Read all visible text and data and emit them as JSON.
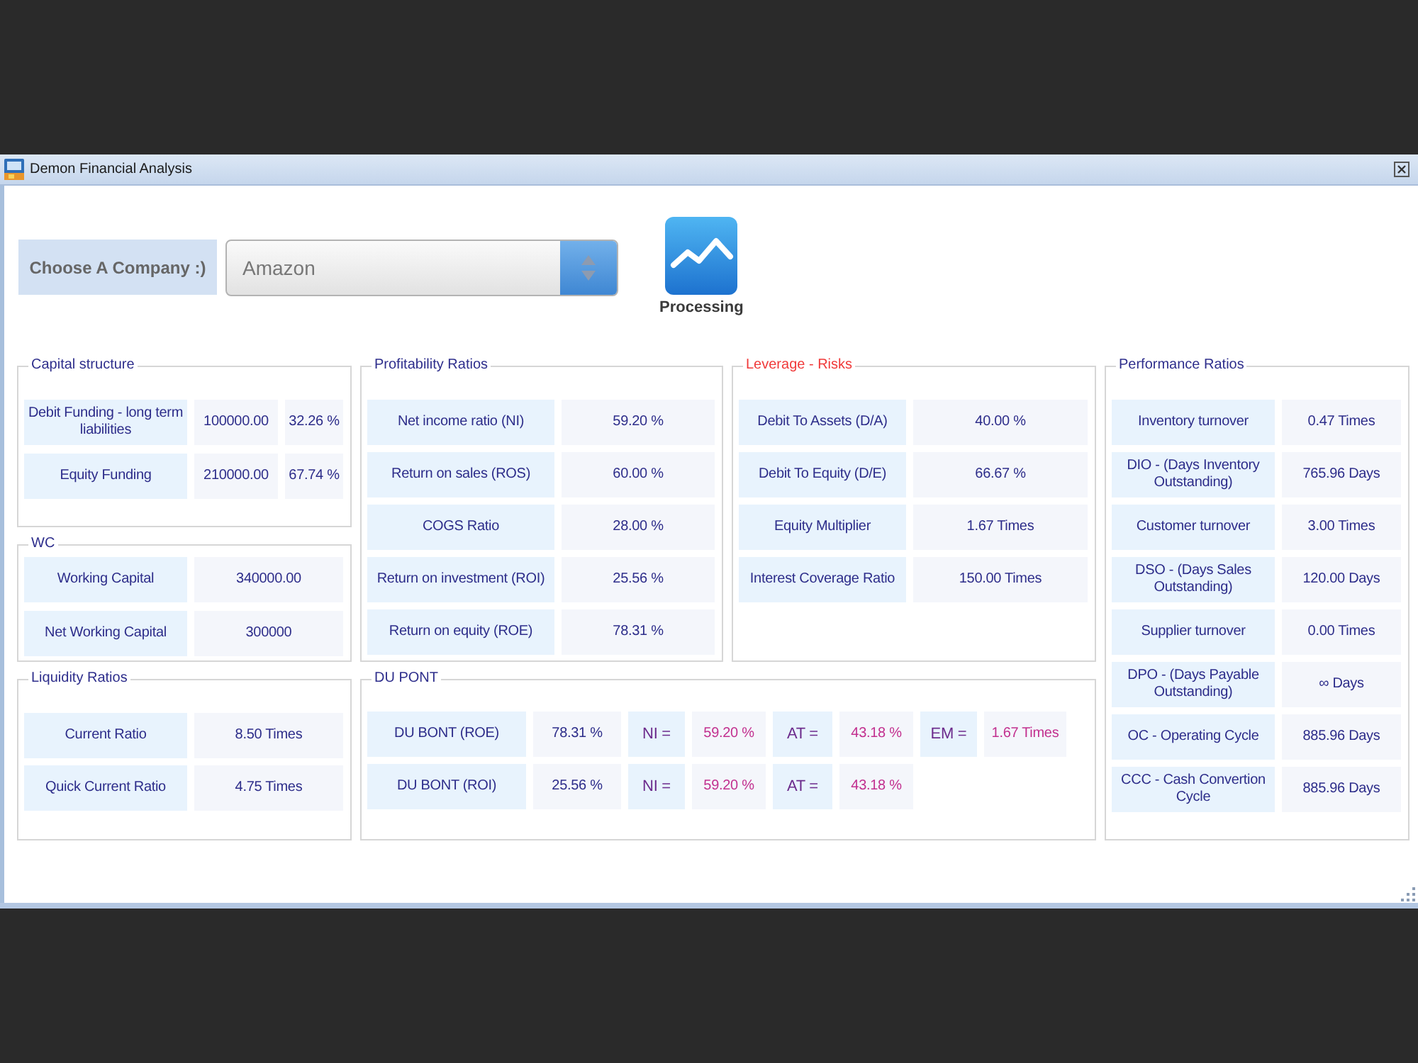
{
  "window": {
    "title": "Demon Financial Analysis"
  },
  "company_picker": {
    "label": "Choose A Company :)",
    "value": "Amazon"
  },
  "processing_button": {
    "label": "Processing"
  },
  "capital_structure": {
    "title": "Capital structure",
    "highlighted": false,
    "rows": [
      {
        "label": "Debit Funding - long term liabilities",
        "value": "100000.00",
        "share": "32.26 %"
      },
      {
        "label": "Equity Funding",
        "value": "210000.00",
        "share": "67.74 %"
      }
    ]
  },
  "profitability_ratios": {
    "title": "Profitability Ratios",
    "highlighted": false,
    "rows": [
      {
        "label": "Net income ratio (NI)",
        "value": "59.20 %"
      },
      {
        "label": "Return on sales (ROS)",
        "value": "60.00 %"
      },
      {
        "label": "COGS Ratio",
        "value": "28.00 %"
      },
      {
        "label": "Return on investment (ROI)",
        "value": "25.56 %"
      },
      {
        "label": "Return on equity (ROE)",
        "value": "78.31 %"
      }
    ]
  },
  "leverage_risks": {
    "title": "Leverage - Risks",
    "highlighted": true,
    "rows": [
      {
        "label": "Debit To Assets (D/A)",
        "value": "40.00 %"
      },
      {
        "label": "Debit To Equity (D/E)",
        "value": "66.67 %"
      },
      {
        "label": "Equity Multiplier",
        "value": "1.67 Times"
      },
      {
        "label": "Interest Coverage Ratio",
        "value": "150.00 Times"
      }
    ]
  },
  "performance_ratios": {
    "title": "Performance Ratios",
    "highlighted": false,
    "rows": [
      {
        "label": "Inventory turnover",
        "value": "0.47 Times"
      },
      {
        "label": "DIO - (Days Inventory Outstanding)",
        "value": "765.96 Days"
      },
      {
        "label": "Customer turnover",
        "value": "3.00 Times"
      },
      {
        "label": "DSO - (Days Sales Outstanding)",
        "value": "120.00 Days"
      },
      {
        "label": "Supplier turnover",
        "value": "0.00 Times"
      },
      {
        "label": "DPO - (Days Payable Outstanding)",
        "value": "∞ Days"
      },
      {
        "label": "OC - Operating Cycle",
        "value": "885.96 Days"
      },
      {
        "label": "CCC - Cash Convertion Cycle",
        "value": "885.96 Days"
      }
    ]
  },
  "wc": {
    "title": "WC",
    "highlighted": false,
    "rows": [
      {
        "label": "Working Capital",
        "value": "340000.00"
      },
      {
        "label": "Net Working Capital",
        "value": "300000"
      }
    ]
  },
  "liquidity_ratios": {
    "title": "Liquidity Ratios",
    "highlighted": false,
    "rows": [
      {
        "label": "Current Ratio",
        "value": "8.50 Times"
      },
      {
        "label": "Quick Current Ratio",
        "value": "4.75 Times"
      }
    ]
  },
  "du_pont": {
    "title": "DU PONT",
    "highlighted": false,
    "rows": [
      {
        "label": "DU BONT (ROE)",
        "value": "78.31 %",
        "terms": [
          {
            "label": "NI =",
            "value": "59.20 %"
          },
          {
            "label": "AT =",
            "value": "43.18 %"
          },
          {
            "label": "EM =",
            "value": "1.67 Times"
          }
        ]
      },
      {
        "label": "DU BONT (ROI)",
        "value": "25.56 %",
        "terms": [
          {
            "label": "NI =",
            "value": "59.20 %"
          },
          {
            "label": "AT =",
            "value": "43.18 %"
          }
        ]
      }
    ]
  }
}
